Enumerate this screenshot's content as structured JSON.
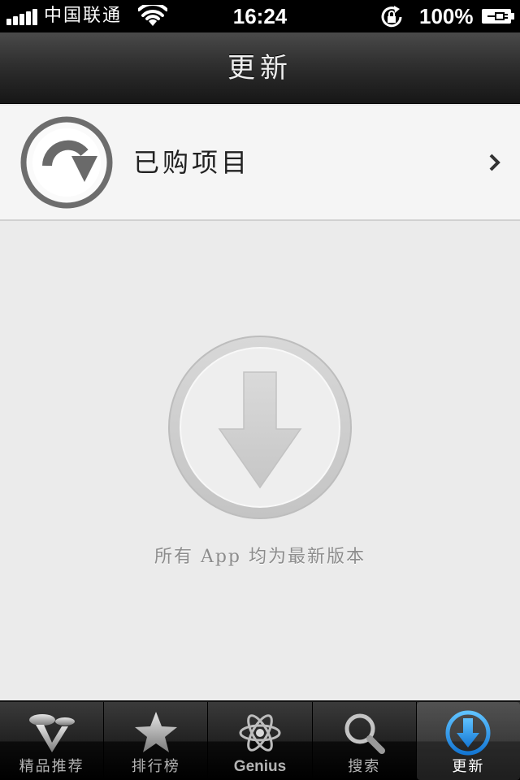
{
  "status_bar": {
    "carrier": "中国联通",
    "time": "16:24",
    "battery_percent": "100%",
    "signal_icon": "signal-bars-icon",
    "wifi_icon": "wifi-icon",
    "rotation_lock_icon": "rotation-lock-icon",
    "battery_icon": "battery-charging-icon"
  },
  "nav_bar": {
    "title": "更新"
  },
  "purchased": {
    "label": "已购项目",
    "icon": "purchased-arrow-icon",
    "chevron_icon": "chevron-right-icon"
  },
  "empty_state": {
    "icon": "download-arrow-icon",
    "message": "所有 App 均为最新版本"
  },
  "tab_bar": {
    "tabs": [
      {
        "label": "精品推荐",
        "icon": "featured-icon",
        "active": false
      },
      {
        "label": "排行榜",
        "icon": "star-icon",
        "active": false
      },
      {
        "label": "Genius",
        "icon": "genius-atom-icon",
        "active": false
      },
      {
        "label": "搜索",
        "icon": "search-icon",
        "active": false
      },
      {
        "label": "更新",
        "icon": "updates-icon",
        "active": true
      }
    ]
  },
  "colors": {
    "active_tab_icon": "#1e8fe8",
    "inactive_tab_label": "#b4b4b4",
    "content_background": "#ebebeb"
  }
}
